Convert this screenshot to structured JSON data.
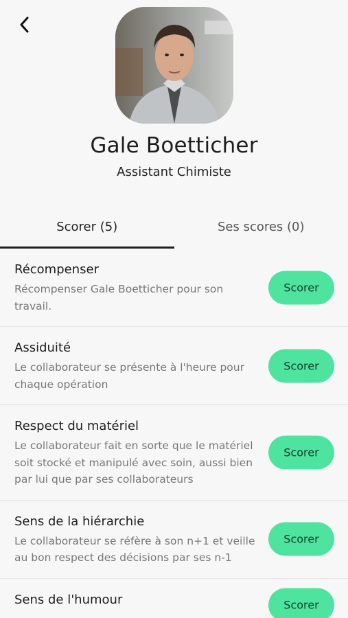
{
  "header": {
    "back_icon": "chevron-left-icon"
  },
  "profile": {
    "name": "Gale Boetticher",
    "role": "Assistant Chimiste",
    "avatar_alt": "avatar"
  },
  "tabs": [
    {
      "label": "Scorer (5)",
      "active": true
    },
    {
      "label": "Ses scores (0)",
      "active": false
    }
  ],
  "items": [
    {
      "title": "Récompenser",
      "description": "Récompenser Gale Boetticher pour son travail.",
      "button": "Scorer"
    },
    {
      "title": "Assiduité",
      "description": "Le collaborateur se présente à l'heure pour chaque opération",
      "button": "Scorer"
    },
    {
      "title": "Respect du matériel",
      "description": "Le collaborateur fait en sorte que le matériel soit stocké et manipulé avec soin, aussi bien par lui que par ses collaborateurs",
      "button": "Scorer"
    },
    {
      "title": "Sens de la hiérarchie",
      "description": "Le collaborateur se réfère à son n+1 et veille au bon respect des décisions par ses n-1",
      "button": "Scorer"
    },
    {
      "title": "Sens de l'humour",
      "description": "",
      "button": "Scorer"
    }
  ],
  "colors": {
    "accent": "#4fe3a0",
    "background": "#f7f7f7",
    "text_secondary": "#777777"
  }
}
